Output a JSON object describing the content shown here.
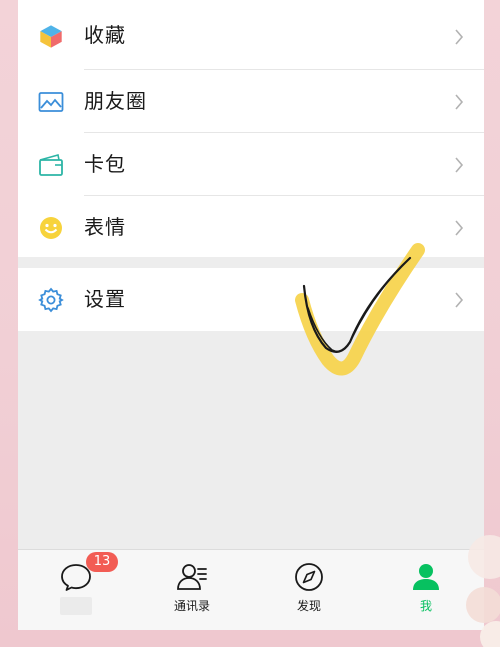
{
  "menu": {
    "items": [
      {
        "label": "收藏",
        "icon": "favorites-cube-icon"
      },
      {
        "label": "朋友圈",
        "icon": "moments-picture-icon"
      },
      {
        "label": "卡包",
        "icon": "card-wallet-icon"
      },
      {
        "label": "表情",
        "icon": "smiley-face-icon"
      }
    ],
    "settings": {
      "label": "设置",
      "icon": "gear-icon"
    }
  },
  "tabbar": {
    "chats": {
      "label": "",
      "badge": "13",
      "icon": "chat-bubble-icon"
    },
    "contacts": {
      "label": "通讯录",
      "icon": "contacts-icon"
    },
    "discover": {
      "label": "发现",
      "icon": "compass-icon"
    },
    "me": {
      "label": "我",
      "icon": "person-icon"
    }
  },
  "colors": {
    "accent": "#07c160",
    "badge": "#f25c54",
    "background": "#ededed",
    "annotation_yellow": "#f6d34a"
  }
}
